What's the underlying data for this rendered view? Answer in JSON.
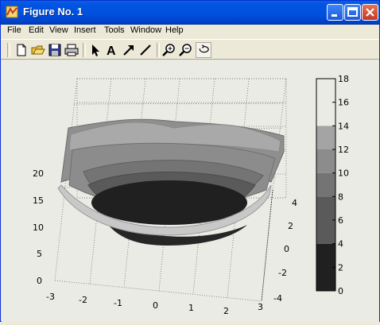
{
  "window": {
    "title": "Figure No. 1",
    "icon": "matlab-logo-icon"
  },
  "menu": [
    "File",
    "Edit",
    "View",
    "Insert",
    "Tools",
    "Window",
    "Help"
  ],
  "toolbar_icons": [
    "new-figure-icon",
    "open-file-icon",
    "save-icon",
    "print-icon",
    "edit-plot-arrow-icon",
    "insert-text-icon",
    "insert-arrow-icon",
    "insert-line-icon",
    "zoom-in-icon",
    "zoom-out-icon",
    "rotate-3d-icon"
  ],
  "chart_data": {
    "type": "surface",
    "colormap": "gray",
    "x_ticks": [
      "-3",
      "-2",
      "-1",
      "0",
      "1",
      "2",
      "3"
    ],
    "y_ticks": [
      "-4",
      "-2",
      "0",
      "2",
      "4"
    ],
    "z_ticks": [
      "0",
      "5",
      "10",
      "15",
      "20"
    ],
    "colorbar_ticks": [
      "0",
      "2",
      "4",
      "6",
      "8",
      "10",
      "12",
      "14",
      "16",
      "18"
    ],
    "colorbar_range": [
      0,
      18
    ],
    "colorbar_bands": [
      {
        "from": 0,
        "to": 4,
        "color": "#202020"
      },
      {
        "from": 4,
        "to": 8,
        "color": "#5a5a5a"
      },
      {
        "from": 8,
        "to": 10,
        "color": "#747474"
      },
      {
        "from": 10,
        "to": 12,
        "color": "#8c8c8c"
      },
      {
        "from": 12,
        "to": 14,
        "color": "#a4a4a4"
      },
      {
        "from": 14,
        "to": 18,
        "color": "#ebebe6"
      }
    ],
    "grid": true
  }
}
